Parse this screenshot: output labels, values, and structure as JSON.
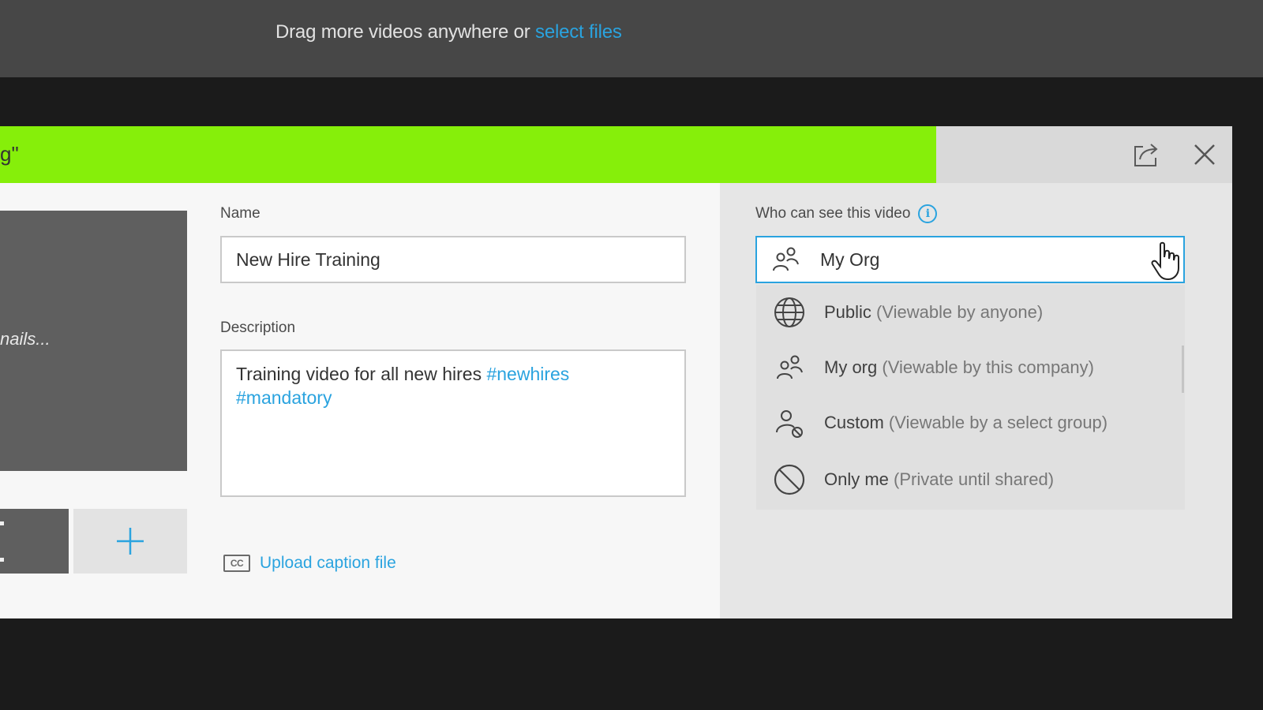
{
  "top_bar": {
    "drag_text": "Drag more videos anywhere or",
    "select_files": "select files"
  },
  "upload": {
    "title_fragment": "g\"",
    "progress": 0.76,
    "progress_color": "#86ef0a"
  },
  "thumbnails": {
    "placeholder_text": "nails..."
  },
  "form": {
    "name_label": "Name",
    "name_value": "New Hire Training",
    "description_label": "Description",
    "description_text": "Training video for all new hires",
    "hashtag_1": "#newhires",
    "hashtag_2": "#mandatory",
    "caption_icon_text": "CC",
    "caption_link": "Upload caption file"
  },
  "visibility": {
    "label": "Who can see this video",
    "info_icon_text": "i",
    "selected": "My Org",
    "options": [
      {
        "label": "Public",
        "sub": "(Viewable by anyone)",
        "icon": "globe-icon"
      },
      {
        "label": "My org",
        "sub": "(Viewable by this company)",
        "icon": "people-icon"
      },
      {
        "label": "Custom",
        "sub": "(Viewable by a select group)",
        "icon": "custom-group-icon"
      },
      {
        "label": "Only me",
        "sub": "(Private until shared)",
        "icon": "private-icon"
      }
    ]
  },
  "colors": {
    "accent": "#2aa3df",
    "progress": "#86ef0a"
  }
}
